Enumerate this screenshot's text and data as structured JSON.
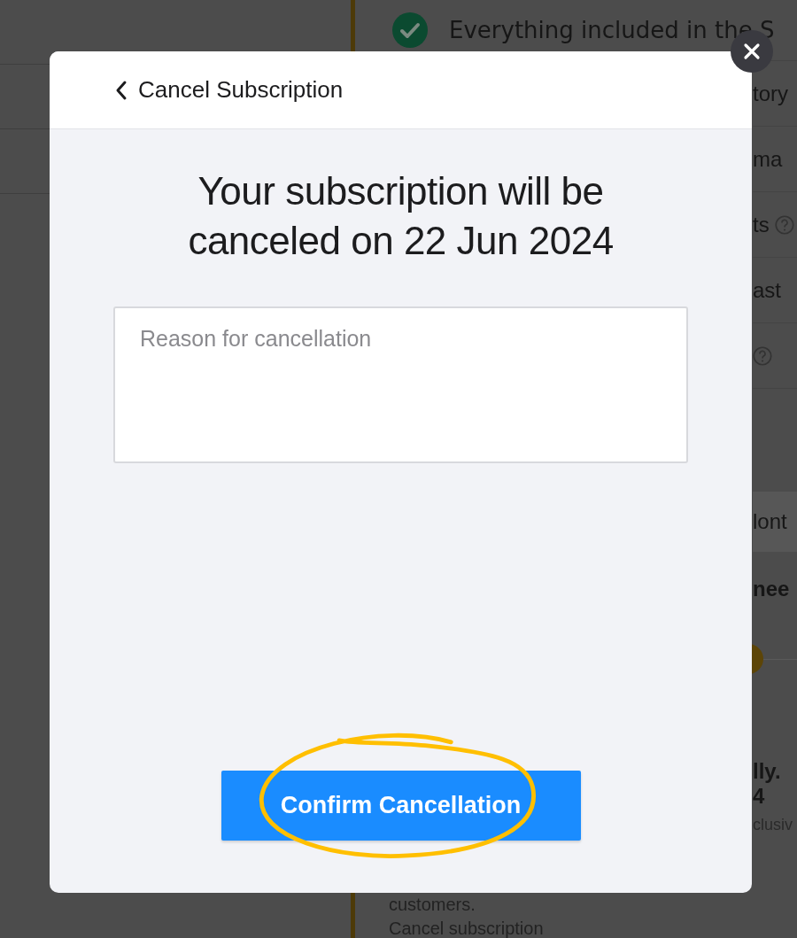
{
  "background": {
    "feature": "Everything included in the S",
    "right_fragments": [
      {
        "kind": "text",
        "text": "tory"
      },
      {
        "kind": "text",
        "text": "ma"
      },
      {
        "kind": "text_help",
        "text": "ts"
      },
      {
        "kind": "text",
        "text": "ast"
      },
      {
        "kind": "help"
      }
    ],
    "plan_tab": "lont",
    "heading": "nee",
    "price_lines": [
      "lly.",
      "4"
    ],
    "note_fragment": "clusiv",
    "note_end": "customers.",
    "cancel_link": "Cancel subscription"
  },
  "modal": {
    "back_label": "Cancel Subscription",
    "title": "Your subscription will be canceled on 22 Jun 2024",
    "reason": {
      "placeholder": "Reason for cancellation"
    },
    "confirm_button": "Confirm Cancellation"
  }
}
